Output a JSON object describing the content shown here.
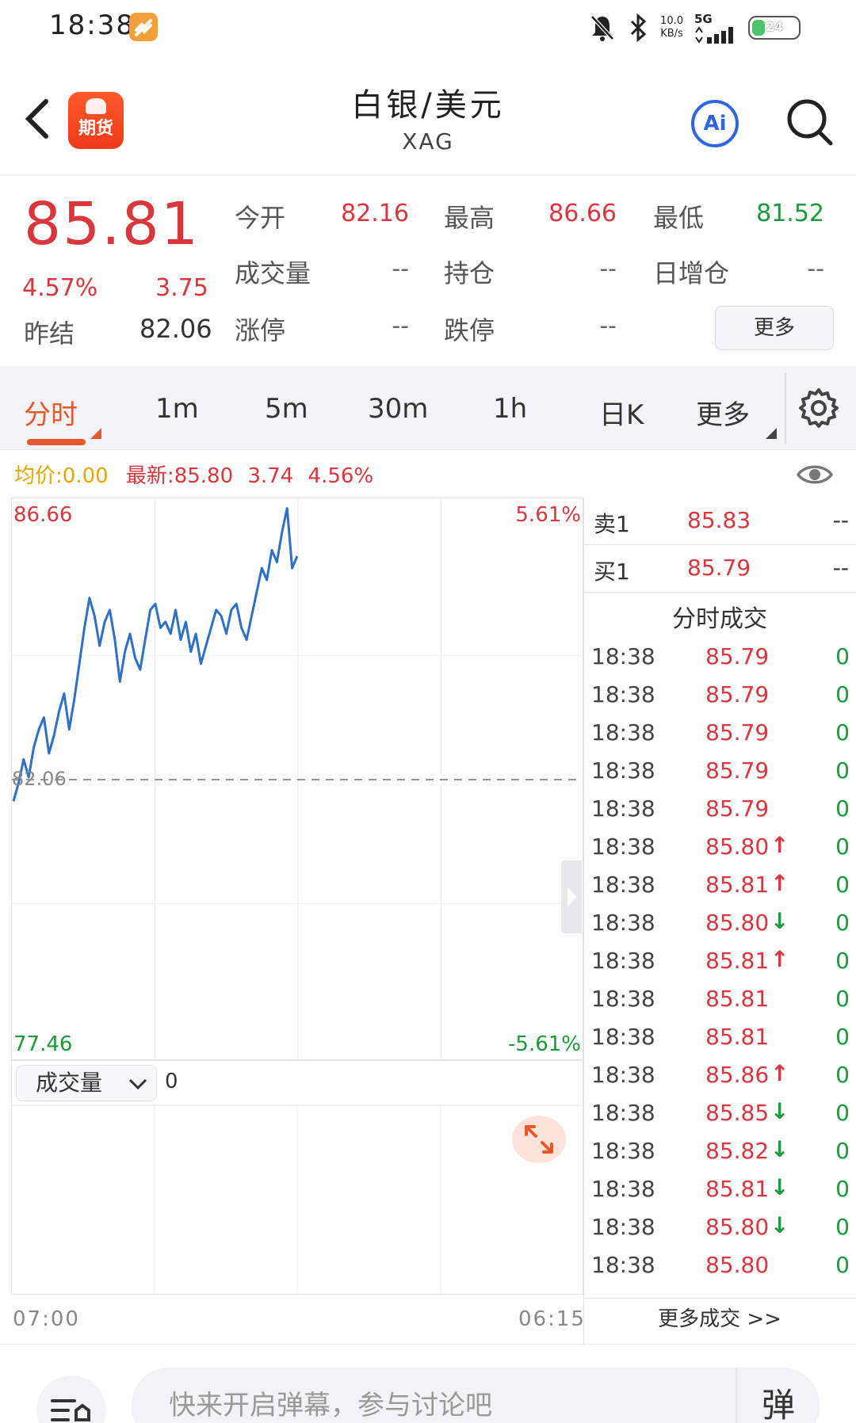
{
  "status_bar": {
    "time": "18:38",
    "net_speed_value": "10.0",
    "net_speed_unit": "KB/s",
    "network": "5G",
    "battery": "24"
  },
  "header": {
    "logo_label": "期货",
    "title": "白银/美元",
    "symbol": "XAG",
    "ai_label": "Ai"
  },
  "quote": {
    "price": "85.81",
    "change_pct": "4.57%",
    "change_value": "3.75",
    "prev_close_label": "昨结",
    "prev_close": "82.06",
    "fields": [
      {
        "label": "今开",
        "value": "82.16",
        "color": "red"
      },
      {
        "label": "最高",
        "value": "86.66",
        "color": "red"
      },
      {
        "label": "最低",
        "value": "81.52",
        "color": "green"
      },
      {
        "label": "成交量",
        "value": "--",
        "color": "gray"
      },
      {
        "label": "持仓",
        "value": "--",
        "color": "gray"
      },
      {
        "label": "日增仓",
        "value": "--",
        "color": "gray"
      },
      {
        "label": "涨停",
        "value": "--",
        "color": "gray"
      },
      {
        "label": "跌停",
        "value": "--",
        "color": "gray"
      }
    ],
    "more_label": "更多"
  },
  "tabs": [
    {
      "label": "分时",
      "active": true
    },
    {
      "label": "1m"
    },
    {
      "label": "5m"
    },
    {
      "label": "30m"
    },
    {
      "label": "1h"
    },
    {
      "label": "日K"
    },
    {
      "label": "更多"
    }
  ],
  "info_line": {
    "avg_label": "均价:",
    "avg_value": "0.00",
    "latest_label": "最新:",
    "latest_value": "85.80",
    "latest_change": "3.74",
    "latest_pct": "4.56%"
  },
  "chart": {
    "y_max_label": "86.66",
    "y_min_label": "77.46",
    "pct_max_label": "5.61%",
    "pct_min_label": "-5.61%",
    "base_label": "82.06",
    "time_start": "07:00",
    "time_end": "06:15",
    "line_color": "#2f6fc6"
  },
  "chart_data": {
    "type": "line",
    "ylim": [
      77.46,
      86.66
    ],
    "baseline": 82.06,
    "values": [
      81.7,
      82.0,
      82.4,
      82.1,
      82.6,
      82.9,
      83.1,
      82.5,
      82.8,
      83.2,
      83.5,
      82.9,
      83.4,
      84.0,
      84.6,
      85.1,
      84.8,
      84.3,
      84.7,
      84.9,
      84.4,
      83.7,
      84.2,
      84.5,
      84.1,
      83.9,
      84.4,
      84.9,
      85.0,
      84.6,
      84.7,
      84.5,
      84.9,
      84.4,
      84.7,
      84.2,
      84.5,
      84.0,
      84.3,
      84.6,
      84.9,
      84.8,
      84.5,
      84.9,
      85.0,
      84.6,
      84.4,
      84.8,
      85.2,
      85.6,
      85.4,
      85.9,
      85.7,
      86.2,
      86.6,
      85.6,
      85.8
    ]
  },
  "volume": {
    "selector_label": "成交量",
    "value": "0"
  },
  "order_book": {
    "ask_label": "卖1",
    "ask_price": "85.83",
    "ask_volume": "--",
    "bid_label": "买1",
    "bid_price": "85.79",
    "bid_volume": "--"
  },
  "trades": {
    "title": "分时成交",
    "rows": [
      {
        "time": "18:38",
        "price": "85.79",
        "arrow": "",
        "volume": "0"
      },
      {
        "time": "18:38",
        "price": "85.79",
        "arrow": "",
        "volume": "0"
      },
      {
        "time": "18:38",
        "price": "85.79",
        "arrow": "",
        "volume": "0"
      },
      {
        "time": "18:38",
        "price": "85.79",
        "arrow": "",
        "volume": "0"
      },
      {
        "time": "18:38",
        "price": "85.79",
        "arrow": "",
        "volume": "0"
      },
      {
        "time": "18:38",
        "price": "85.80",
        "arrow": "up",
        "volume": "0"
      },
      {
        "time": "18:38",
        "price": "85.81",
        "arrow": "up",
        "volume": "0"
      },
      {
        "time": "18:38",
        "price": "85.80",
        "arrow": "down",
        "volume": "0"
      },
      {
        "time": "18:38",
        "price": "85.81",
        "arrow": "up",
        "volume": "0"
      },
      {
        "time": "18:38",
        "price": "85.81",
        "arrow": "",
        "volume": "0"
      },
      {
        "time": "18:38",
        "price": "85.81",
        "arrow": "",
        "volume": "0"
      },
      {
        "time": "18:38",
        "price": "85.86",
        "arrow": "up",
        "volume": "0"
      },
      {
        "time": "18:38",
        "price": "85.85",
        "arrow": "down",
        "volume": "0"
      },
      {
        "time": "18:38",
        "price": "85.82",
        "arrow": "down",
        "volume": "0"
      },
      {
        "time": "18:38",
        "price": "85.81",
        "arrow": "down",
        "volume": "0"
      },
      {
        "time": "18:38",
        "price": "85.80",
        "arrow": "down",
        "volume": "0"
      },
      {
        "time": "18:38",
        "price": "85.80",
        "arrow": "",
        "volume": "0"
      }
    ],
    "more_label": "更多成交 >>"
  },
  "bottom_bar": {
    "input_placeholder": "快来开启弹幕，参与讨论吧",
    "danmu_label": "弹"
  }
}
